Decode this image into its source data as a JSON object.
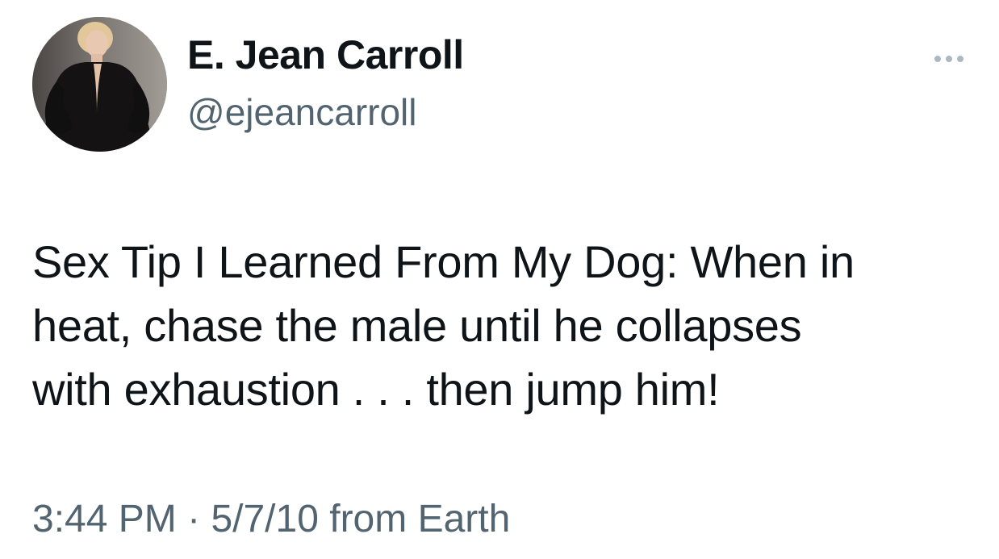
{
  "tweet": {
    "author": {
      "display_name": "E. Jean Carroll",
      "handle": "@ejeancarroll"
    },
    "more_icon": "more-horizontal-icon",
    "text": "Sex Tip I Learned From My Dog:  When in\nheat, chase the male until he collapses\nwith exhaustion  . . . then jump him!",
    "meta": {
      "time": "3:44 PM",
      "separator": "·",
      "date": "5/7/10",
      "source": "from Earth"
    }
  },
  "colors": {
    "text_primary": "#0f1419",
    "text_secondary": "#536471",
    "more_dots": "#aab8c2",
    "background": "#ffffff"
  }
}
